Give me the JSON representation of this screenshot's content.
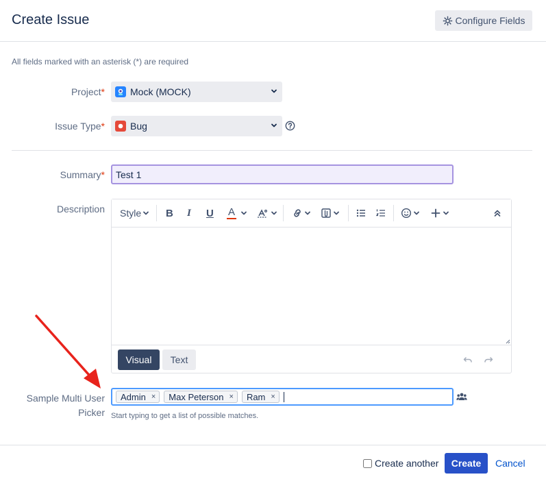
{
  "dialog": {
    "title": "Create Issue",
    "configure_fields_label": "Configure Fields",
    "required_note": "All fields marked with an asterisk (*) are required"
  },
  "fields": {
    "project": {
      "label": "Project",
      "required_mark": "*",
      "value": "Mock (MOCK)"
    },
    "issue_type": {
      "label": "Issue Type",
      "required_mark": "*",
      "value": "Bug"
    },
    "summary": {
      "label": "Summary",
      "required_mark": "*",
      "value": "Test 1"
    },
    "description": {
      "label": "Description"
    },
    "multi_user_picker": {
      "label_line1": "Sample Multi User",
      "label_line2": "Picker",
      "selected": [
        "Admin",
        "Max Peterson",
        "Ram"
      ],
      "remove_glyph": "×",
      "hint": "Start typing to get a list of possible matches."
    }
  },
  "editor": {
    "style_label": "Style",
    "bold": "B",
    "italic": "I",
    "underline": "U",
    "text_color": "A",
    "mode_visual": "Visual",
    "mode_text": "Text",
    "text_color_bar": "#de350b"
  },
  "footer": {
    "create_another_label": "Create another",
    "create_label": "Create",
    "cancel_label": "Cancel"
  },
  "colors": {
    "primary": "#2851c8",
    "link": "#0052cc",
    "required": "#de350b",
    "annotation_arrow": "#e8231c"
  },
  "icons": {
    "configure": "gear-icon",
    "project_avatar": "project-avatar-icon",
    "issue_type": "bug-icon",
    "help": "help-icon",
    "user_picker": "users-icon"
  }
}
